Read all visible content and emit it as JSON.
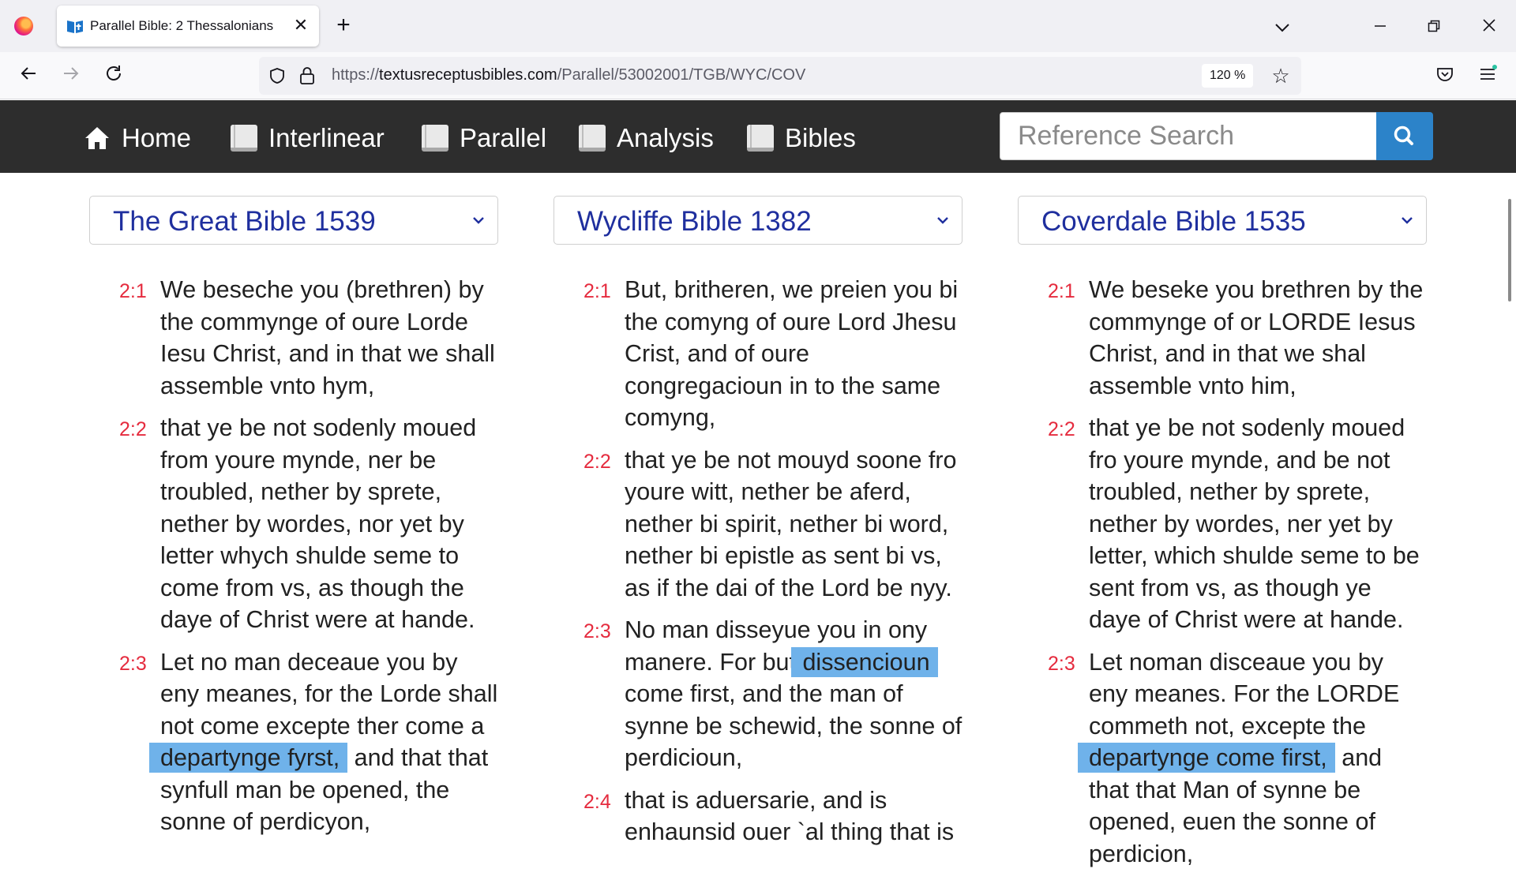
{
  "browser": {
    "tab_title": "Parallel Bible: 2 Thessalonians",
    "url_prefix": "https://",
    "url_host": "textusreceptusbibles.com",
    "url_path": "/Parallel/53002001/TGB/WYC/COV",
    "zoom": "120 %"
  },
  "site_nav": {
    "items": [
      {
        "label": "Home",
        "icon": "home-icon"
      },
      {
        "label": "Interlinear",
        "icon": "book-icon"
      },
      {
        "label": "Parallel",
        "icon": "book-icon"
      },
      {
        "label": "Analysis",
        "icon": "book-icon"
      },
      {
        "label": "Bibles",
        "icon": "book-icon"
      }
    ],
    "search_placeholder": "Reference Search"
  },
  "columns": [
    {
      "version": "The Great Bible 1539",
      "verses": [
        {
          "num": "2:1",
          "text": "We beseche you (brethren) by the commynge of oure Lorde Iesu Christ, and in that we shall assemble vnto hym,"
        },
        {
          "num": "2:2",
          "text": "that ye be not sodenly moued from youre mynde, ner be troubled, nether by sprete, nether by wordes, nor yet by letter whych shulde seme to come from vs, as though the daye of Christ were at hande."
        },
        {
          "num": "2:3",
          "before": "Let no man deceaue you by eny meanes, for the Lorde shall not come excepte ther come a ",
          "highlight": "departynge fyrst,",
          "after": " and that that synfull man be opened, the sonne of perdicyon,"
        }
      ]
    },
    {
      "version": "Wycliffe Bible 1382",
      "verses": [
        {
          "num": "2:1",
          "text": "But, britheren, we preien you bi the comyng of oure Lord Jhesu Crist, and of oure congregacioun in to the same comyng,"
        },
        {
          "num": "2:2",
          "text": "that ye be not mouyd soone fro youre witt, nether be aferd, nether bi spirit, nether bi word, nether bi epistle as sent bi vs, as if the dai of the Lord be nyy."
        },
        {
          "num": "2:3",
          "before": "No man disseyue you in ony manere. For but ",
          "highlight": "dissencioun",
          "after": " come first, and the man of synne be schewid, the sonne of perdicioun,"
        },
        {
          "num": "2:4",
          "text": "that is aduersarie, and is enhaunsid ouer `al thing that is"
        }
      ]
    },
    {
      "version": "Coverdale Bible 1535",
      "verses": [
        {
          "num": "2:1",
          "text": "We beseke you brethren by the commynge of or LORDE Iesus Christ, and in that we shal assemble vnto him,"
        },
        {
          "num": "2:2",
          "text": "that ye be not sodenly moued fro youre mynde, and be not troubled, nether by sprete, nether by wordes, ner yet by letter, which shulde seme to be sent from vs, as though ye daye of Christ were at hande."
        },
        {
          "num": "2:3",
          "before": "Let noman disceaue you by eny meanes. For the LORDE commeth not, excepte the ",
          "highlight": "departynge come first,",
          "after": " and that that Man of synne be opened, euen the sonne of perdicion,"
        }
      ]
    }
  ],
  "colors": {
    "verse_number": "#e52b3e",
    "version_title": "#1f2f9e",
    "highlight": "#6fb2ea",
    "header_bg": "#2d2d2d",
    "search_button": "#2c83c9"
  }
}
